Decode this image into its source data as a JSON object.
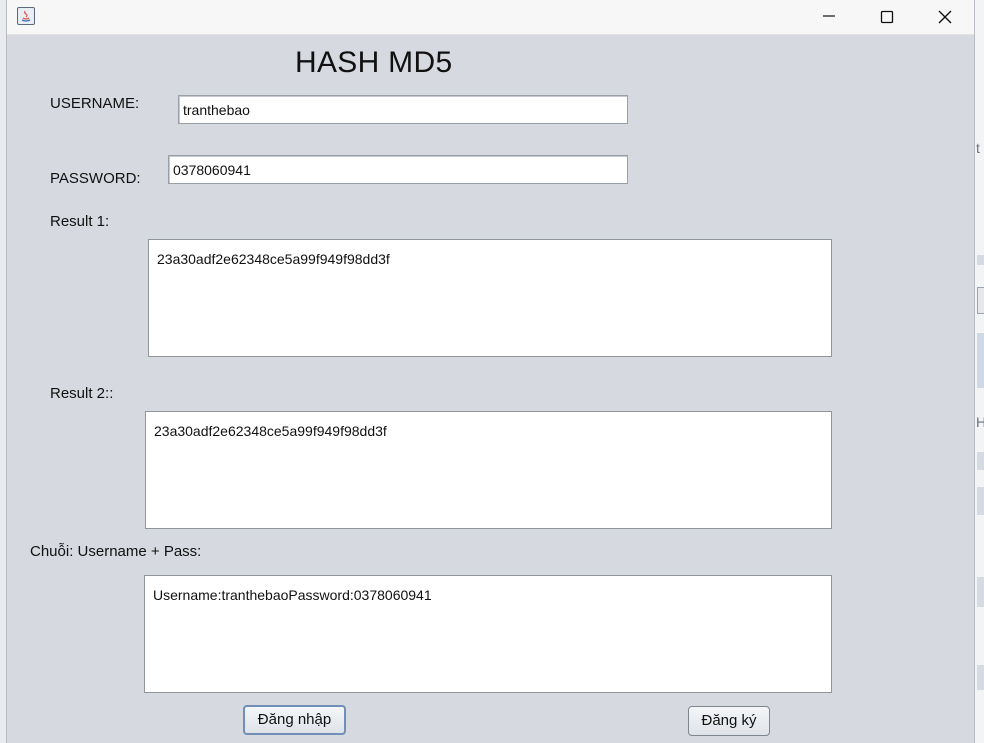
{
  "window": {
    "title_icon": "java-icon",
    "controls": {
      "minimize": "minimize-icon",
      "maximize": "maximize-icon",
      "close": "close-icon"
    }
  },
  "form": {
    "heading": "HASH MD5",
    "username_label": "USERNAME:",
    "username_value": "tranthebao",
    "password_label": "PASSWORD:",
    "password_value": "0378060941",
    "result1_label": "Result 1:",
    "result1_value": "23a30adf2e62348ce5a99f949f98dd3f",
    "result2_label": "Result 2::",
    "result2_value": "23a30adf2e62348ce5a99f949f98dd3f",
    "concat_label": "Chuỗi: Username + Pass:",
    "concat_value": "Username:tranthebaoPassword:0378060941",
    "login_button": "Đăng nhập",
    "register_button": "Đăng ký"
  },
  "background_app": {
    "glyph_t": "t",
    "glyph_h": "H"
  }
}
